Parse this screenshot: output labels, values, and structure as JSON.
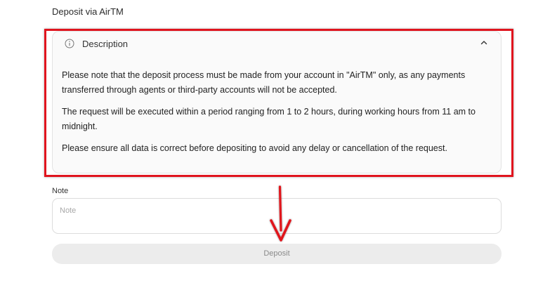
{
  "header": {
    "title": "Deposit via AirTM"
  },
  "description": {
    "title": "Description",
    "icon": "info-icon",
    "toggle_icon": "chevron-up-icon",
    "paragraphs": [
      "Please note that the deposit process must be made from your account in \"AirTM\" only, as any payments transferred through agents or third-party accounts will not be accepted.",
      "The request will be executed within a period ranging from 1 to 2 hours, during working hours from 11 am to midnight.",
      "Please ensure all data is correct before depositing to avoid any delay or cancellation of the request."
    ]
  },
  "note": {
    "label": "Note",
    "placeholder": "Note",
    "value": ""
  },
  "deposit_button": {
    "label": "Deposit"
  },
  "annotation": {
    "color": "#e0141e"
  }
}
